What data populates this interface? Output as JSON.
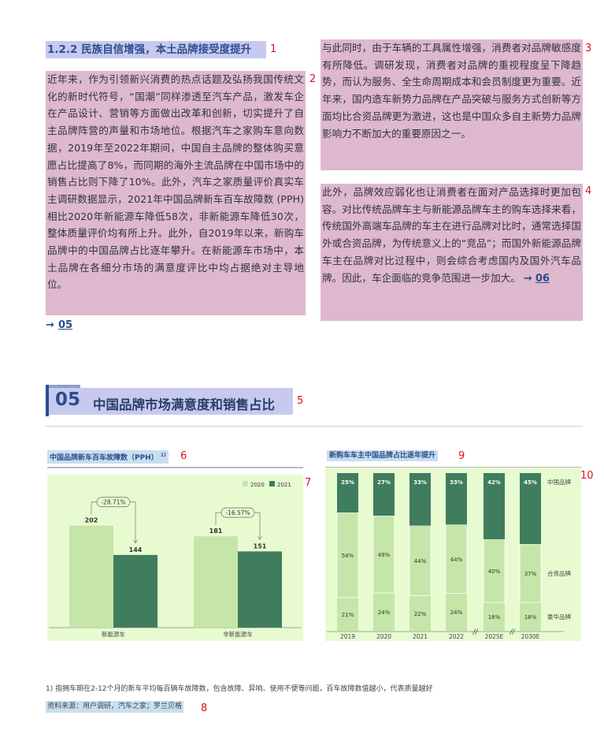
{
  "section": {
    "heading": "1.2.2 民族自信增强，本土品牌接受度提升",
    "left_paragraph": "近年来，作为引领新兴消费的热点话题及弘扬我国传统文化的新时代符号，“国潮”同样渗透至汽车产品，激发车企在产品设计、营销等方面做出改革和创新，切实提升了自主品牌阵营的声量和市场地位。根据汽车之家购车意向数据，2019年至2022年期间，中国自主品牌的整体购买意愿占比提高了8%，而同期的海外主流品牌在中国市场中的销售占比则下降了10%。此外，汽车之家质量评价真实车主调研数据显示，2021年中国品牌新车百车故障数 (PPH) 相比2020年新能源车降低58次，非新能源车降低30次，整体质量评价均有所上升。此外，自2019年以来，新购车品牌中的中国品牌占比逐年攀升。在新能源车市场中，本土品牌在各细分市场的满意度评比中均占据绝对主导地位。",
    "left_link_arrow": "→",
    "left_link": "05",
    "right_paragraph_1": "与此同时，由于车辆的工具属性增强，消费者对品牌敏感度有所降低。调研发现，消费者对品牌的重视程度呈下降趋势，而认为服务、全生命周期成本和会员制度更为重要。近年来，国内造车新势力品牌在产品突破与服务方式创新等方面均比合资品牌更为激进，这也是中国众多自主新势力品牌影响力不断加大的重要原因之一。",
    "right_paragraph_2": "此外，品牌效应弱化也让消费者在面对产品选择时更加包容。对比传统品牌车主与新能源品牌车主的购车选择来看，传统国外高端车品牌的车主在进行品牌对比时，通常选择国外或合资品牌，为传统意义上的“竞品”；而国外新能源品牌车主在品牌对比过程中，则会综合考虑国内及国外汽车品牌。因此，车企面临的竞争范围进一步加大。",
    "right_link_arrow": "→",
    "right_link": "06"
  },
  "figure": {
    "number": "05",
    "title": "中国品牌市场满意度和销售占比"
  },
  "annotations": [
    "1",
    "2",
    "3",
    "4",
    "5",
    "6",
    "7",
    "8",
    "9",
    "10"
  ],
  "colors": {
    "light_bar": "#c6e5a8",
    "dark_bar": "#3f7d5e",
    "chart_bg": "#e8fbd0",
    "highlight_blue": "#c8dff0",
    "highlight_purple": "#c8c9ef",
    "highlight_pink": "#ddb8cf",
    "annotation": "#e0101a"
  },
  "chart_data": [
    {
      "type": "bar",
      "title": "中国品牌新车百车故障数（PPH）",
      "title_sup": "1)",
      "categories": [
        "新能源车",
        "非新能源车"
      ],
      "series": [
        {
          "name": "2020",
          "values": [
            202,
            181
          ]
        },
        {
          "name": "2021",
          "values": [
            144,
            151
          ]
        }
      ],
      "changes": [
        "-28.71%",
        "-16.57%"
      ],
      "ylim": [
        0,
        250
      ],
      "legend": "top-right"
    },
    {
      "type": "bar",
      "stacked": true,
      "title": "新购车车主中国品牌占比逐年提升",
      "categories": [
        "2019",
        "2020",
        "2021",
        "2022",
        "2025E",
        "2030E"
      ],
      "series": [
        {
          "name": "豪华品牌",
          "values": [
            21,
            24,
            22,
            24,
            18,
            18
          ]
        },
        {
          "name": "合资品牌",
          "values": [
            54,
            49,
            44,
            44,
            40,
            37
          ]
        },
        {
          "name": "中国品牌",
          "values": [
            25,
            27,
            33,
            33,
            42,
            45
          ]
        }
      ],
      "labels": [
        "21%",
        "24%",
        "22%",
        "24%",
        "18%",
        "18%",
        "54%",
        "49%",
        "44%",
        "44%",
        "40%",
        "37%",
        "25%",
        "27%",
        "33%",
        "33%",
        "42%",
        "45%"
      ],
      "axis_break_marks": [
        "//",
        "//"
      ],
      "ylim": [
        0,
        100
      ],
      "legend": "right"
    }
  ],
  "footnote": "1) 指拥车期在2-12个月的新车平均每百辆车故障数，包含故障、异响、使用不便等问题，百车故障数值越小，代表质量越好",
  "source": "资料来源：用户调研，汽车之家；罗兰贝格"
}
